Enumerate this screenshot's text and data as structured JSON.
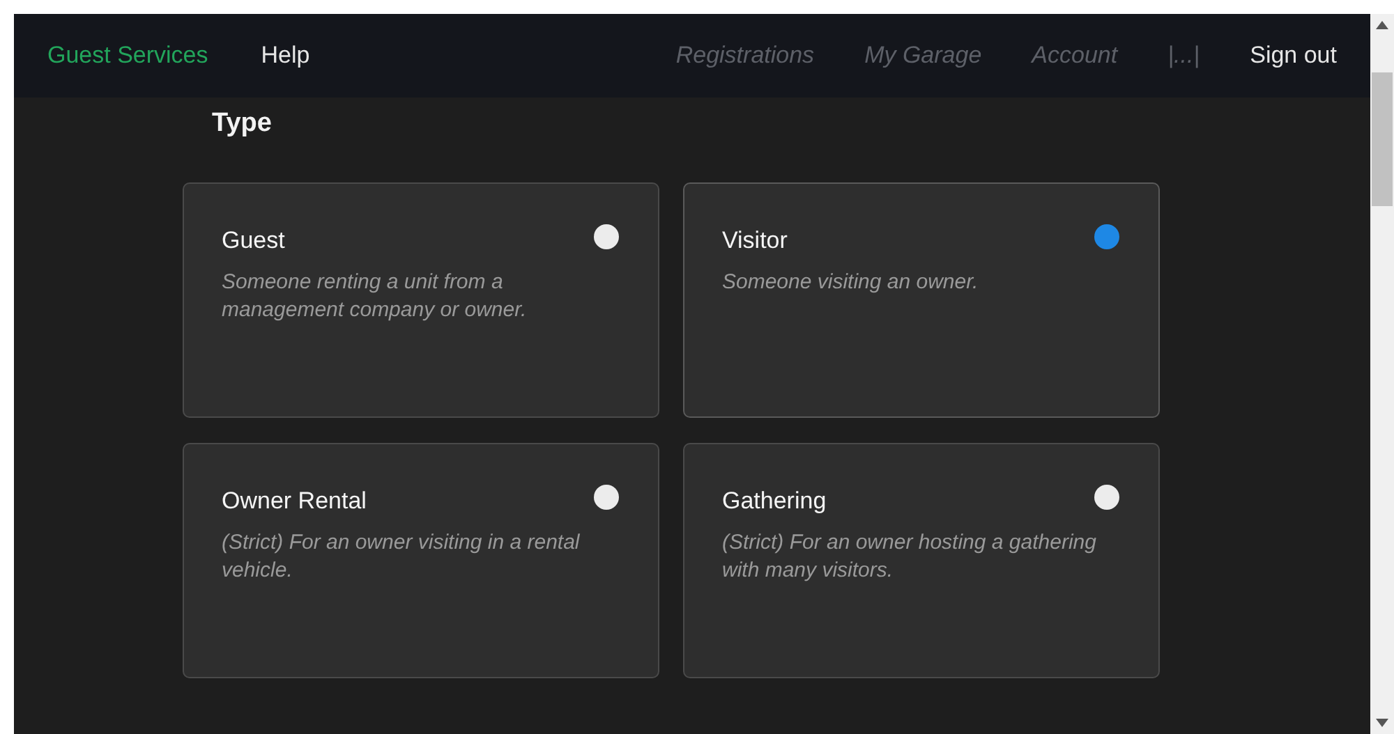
{
  "nav": {
    "brand": "Guest Services",
    "left": [
      {
        "label": "Help",
        "disabled": false
      }
    ],
    "right": [
      {
        "label": "Registrations",
        "disabled": true
      },
      {
        "label": "My Garage",
        "disabled": true
      },
      {
        "label": "Account",
        "disabled": true
      },
      {
        "label": "|...|",
        "disabled": true
      },
      {
        "label": "Sign out",
        "disabled": false
      }
    ]
  },
  "section_title": "Type",
  "options": [
    {
      "title": "Guest",
      "description": "Someone renting a unit from a management company or owner.",
      "selected": false
    },
    {
      "title": "Visitor",
      "description": "Someone visiting an owner.",
      "selected": true
    },
    {
      "title": "Owner Rental",
      "description": "(Strict) For an owner visiting in a rental vehicle.",
      "selected": false
    },
    {
      "title": "Gathering",
      "description": "(Strict) For an owner hosting a gathering with many visitors.",
      "selected": false
    }
  ]
}
